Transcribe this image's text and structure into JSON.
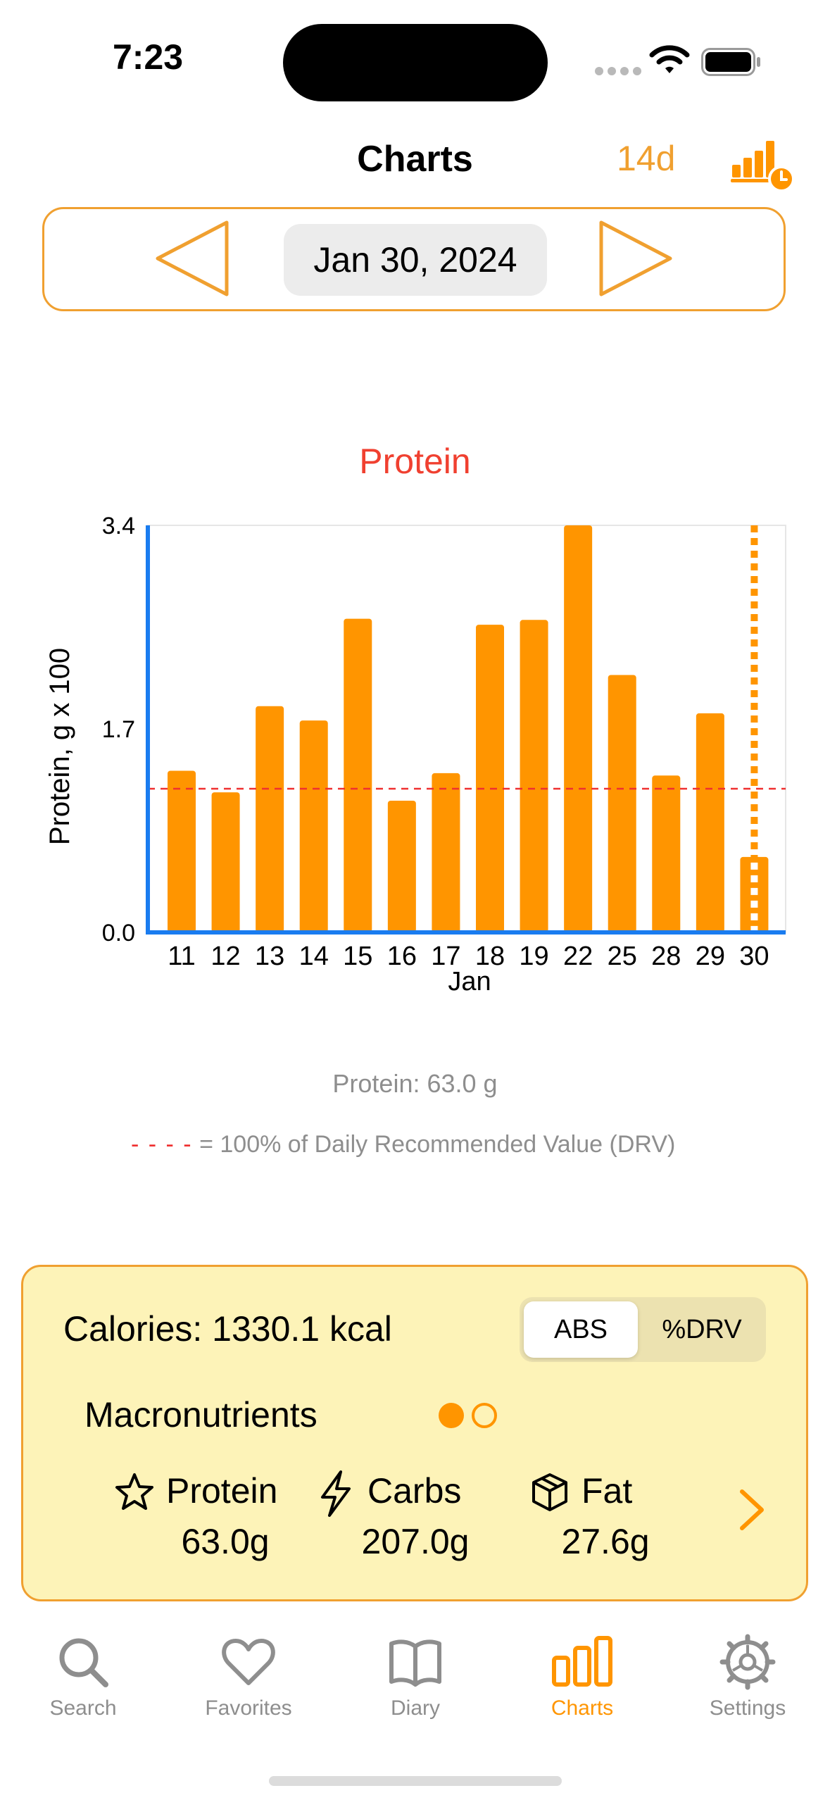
{
  "status_bar": {
    "time": "7:23"
  },
  "header": {
    "title": "Charts",
    "range_label": "14d"
  },
  "date_nav": {
    "date": "Jan 30, 2024"
  },
  "chart_data": {
    "type": "bar",
    "title": "Protein",
    "ylabel": "Protein,   g  x 100",
    "xlabel": "Jan",
    "categories": [
      "11",
      "12",
      "13",
      "14",
      "15",
      "16",
      "17",
      "18",
      "19",
      "22",
      "25",
      "28",
      "29",
      "30"
    ],
    "values": [
      1.35,
      1.17,
      1.89,
      1.77,
      2.62,
      1.1,
      1.33,
      2.57,
      2.61,
      3.4,
      2.15,
      1.31,
      1.83,
      0.63
    ],
    "reference_line": 1.2,
    "ylim": [
      0,
      3.4
    ],
    "yticks": [
      "3.4",
      "1.7",
      "0.0"
    ],
    "selected_category": "30",
    "colors": {
      "bar": "#ff9500",
      "reference": "#ef3030",
      "axis": "#1a7cf0"
    }
  },
  "chart_readout": "Protein: 63.0 g",
  "legend": {
    "dash": "- - - -",
    "text": " = 100% of Daily Recommended Value (DRV)"
  },
  "summary": {
    "calories": "Calories: 1330.1 kcal",
    "segment": {
      "abs": "ABS",
      "drv": "%DRV",
      "selected": "ABS"
    },
    "macros_label": "Macronutrients",
    "macros": [
      {
        "name": "Protein",
        "value": "63.0g",
        "icon": "star-icon"
      },
      {
        "name": "Carbs",
        "value": "207.0g",
        "icon": "bolt-icon"
      },
      {
        "name": "Fat",
        "value": "27.6g",
        "icon": "cube-icon"
      }
    ]
  },
  "tabs": [
    {
      "label": "Search",
      "icon": "search-icon"
    },
    {
      "label": "Favorites",
      "icon": "heart-icon"
    },
    {
      "label": "Diary",
      "icon": "book-icon"
    },
    {
      "label": "Charts",
      "icon": "chart-icon",
      "active": true
    },
    {
      "label": "Settings",
      "icon": "gear-icon"
    }
  ],
  "accent_color": "#ff9500"
}
